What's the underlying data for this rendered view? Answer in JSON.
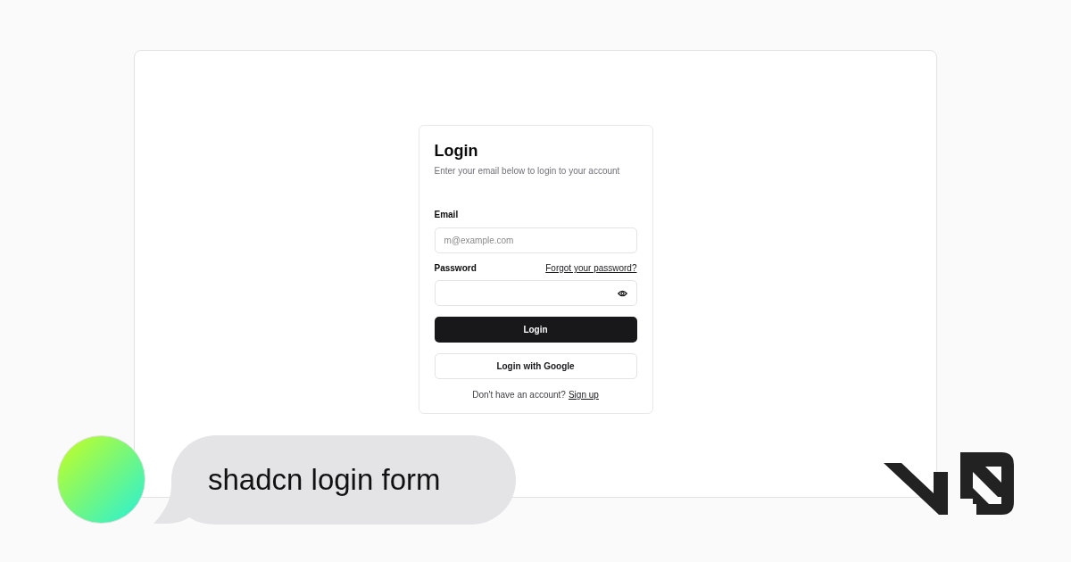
{
  "login_card": {
    "title": "Login",
    "description": "Enter your email below to login to your account",
    "email": {
      "label": "Email",
      "placeholder": "m@example.com"
    },
    "password": {
      "label": "Password",
      "forgot_link": "Forgot your password?"
    },
    "submit_button": "Login",
    "google_button": "Login with Google",
    "footer": {
      "text": "Don't have an account?",
      "link": "Sign up"
    }
  },
  "prompt": {
    "text": "shadcn login form"
  }
}
